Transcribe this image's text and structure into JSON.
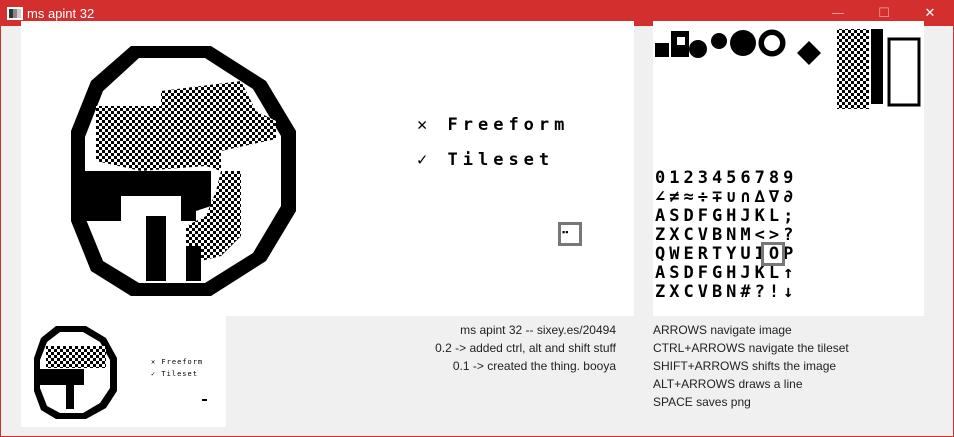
{
  "window": {
    "title": "ms apint 32",
    "accent": "#d32f2f"
  },
  "titlebar_buttons": {
    "minimize": "—",
    "maximize": "☐",
    "close": "✕"
  },
  "canvas": {
    "menu": [
      {
        "mark": "✕",
        "label": "Freeform"
      },
      {
        "mark": "✓",
        "label": "Tileset"
      }
    ],
    "cursor_tile": "▪▪"
  },
  "tileset": {
    "rows": [
      "0123456789",
      "∠≠≈÷∓∪∩∆∇∂",
      "ASDFGHJKL;",
      "ZXCVBNM<>?",
      "QWERTYUIOP",
      "ASDFGHJKL↑",
      "ZXCVBN#?!↓"
    ]
  },
  "preview": {
    "menu": [
      "✕ Freeform",
      "✓ Tileset"
    ]
  },
  "info_right": [
    "ms apint 32 -- sixey.es/20494",
    "0.2 -> added ctrl, alt and shift stuff",
    "0.1 -> created the thing. booya"
  ],
  "info_left": [
    "ARROWS navigate image",
    "CTRL+ARROWS navigate the tileset",
    "SHIFT+ARROWS shifts the image",
    "ALT+ARROWS draws a line",
    "SPACE saves png"
  ]
}
